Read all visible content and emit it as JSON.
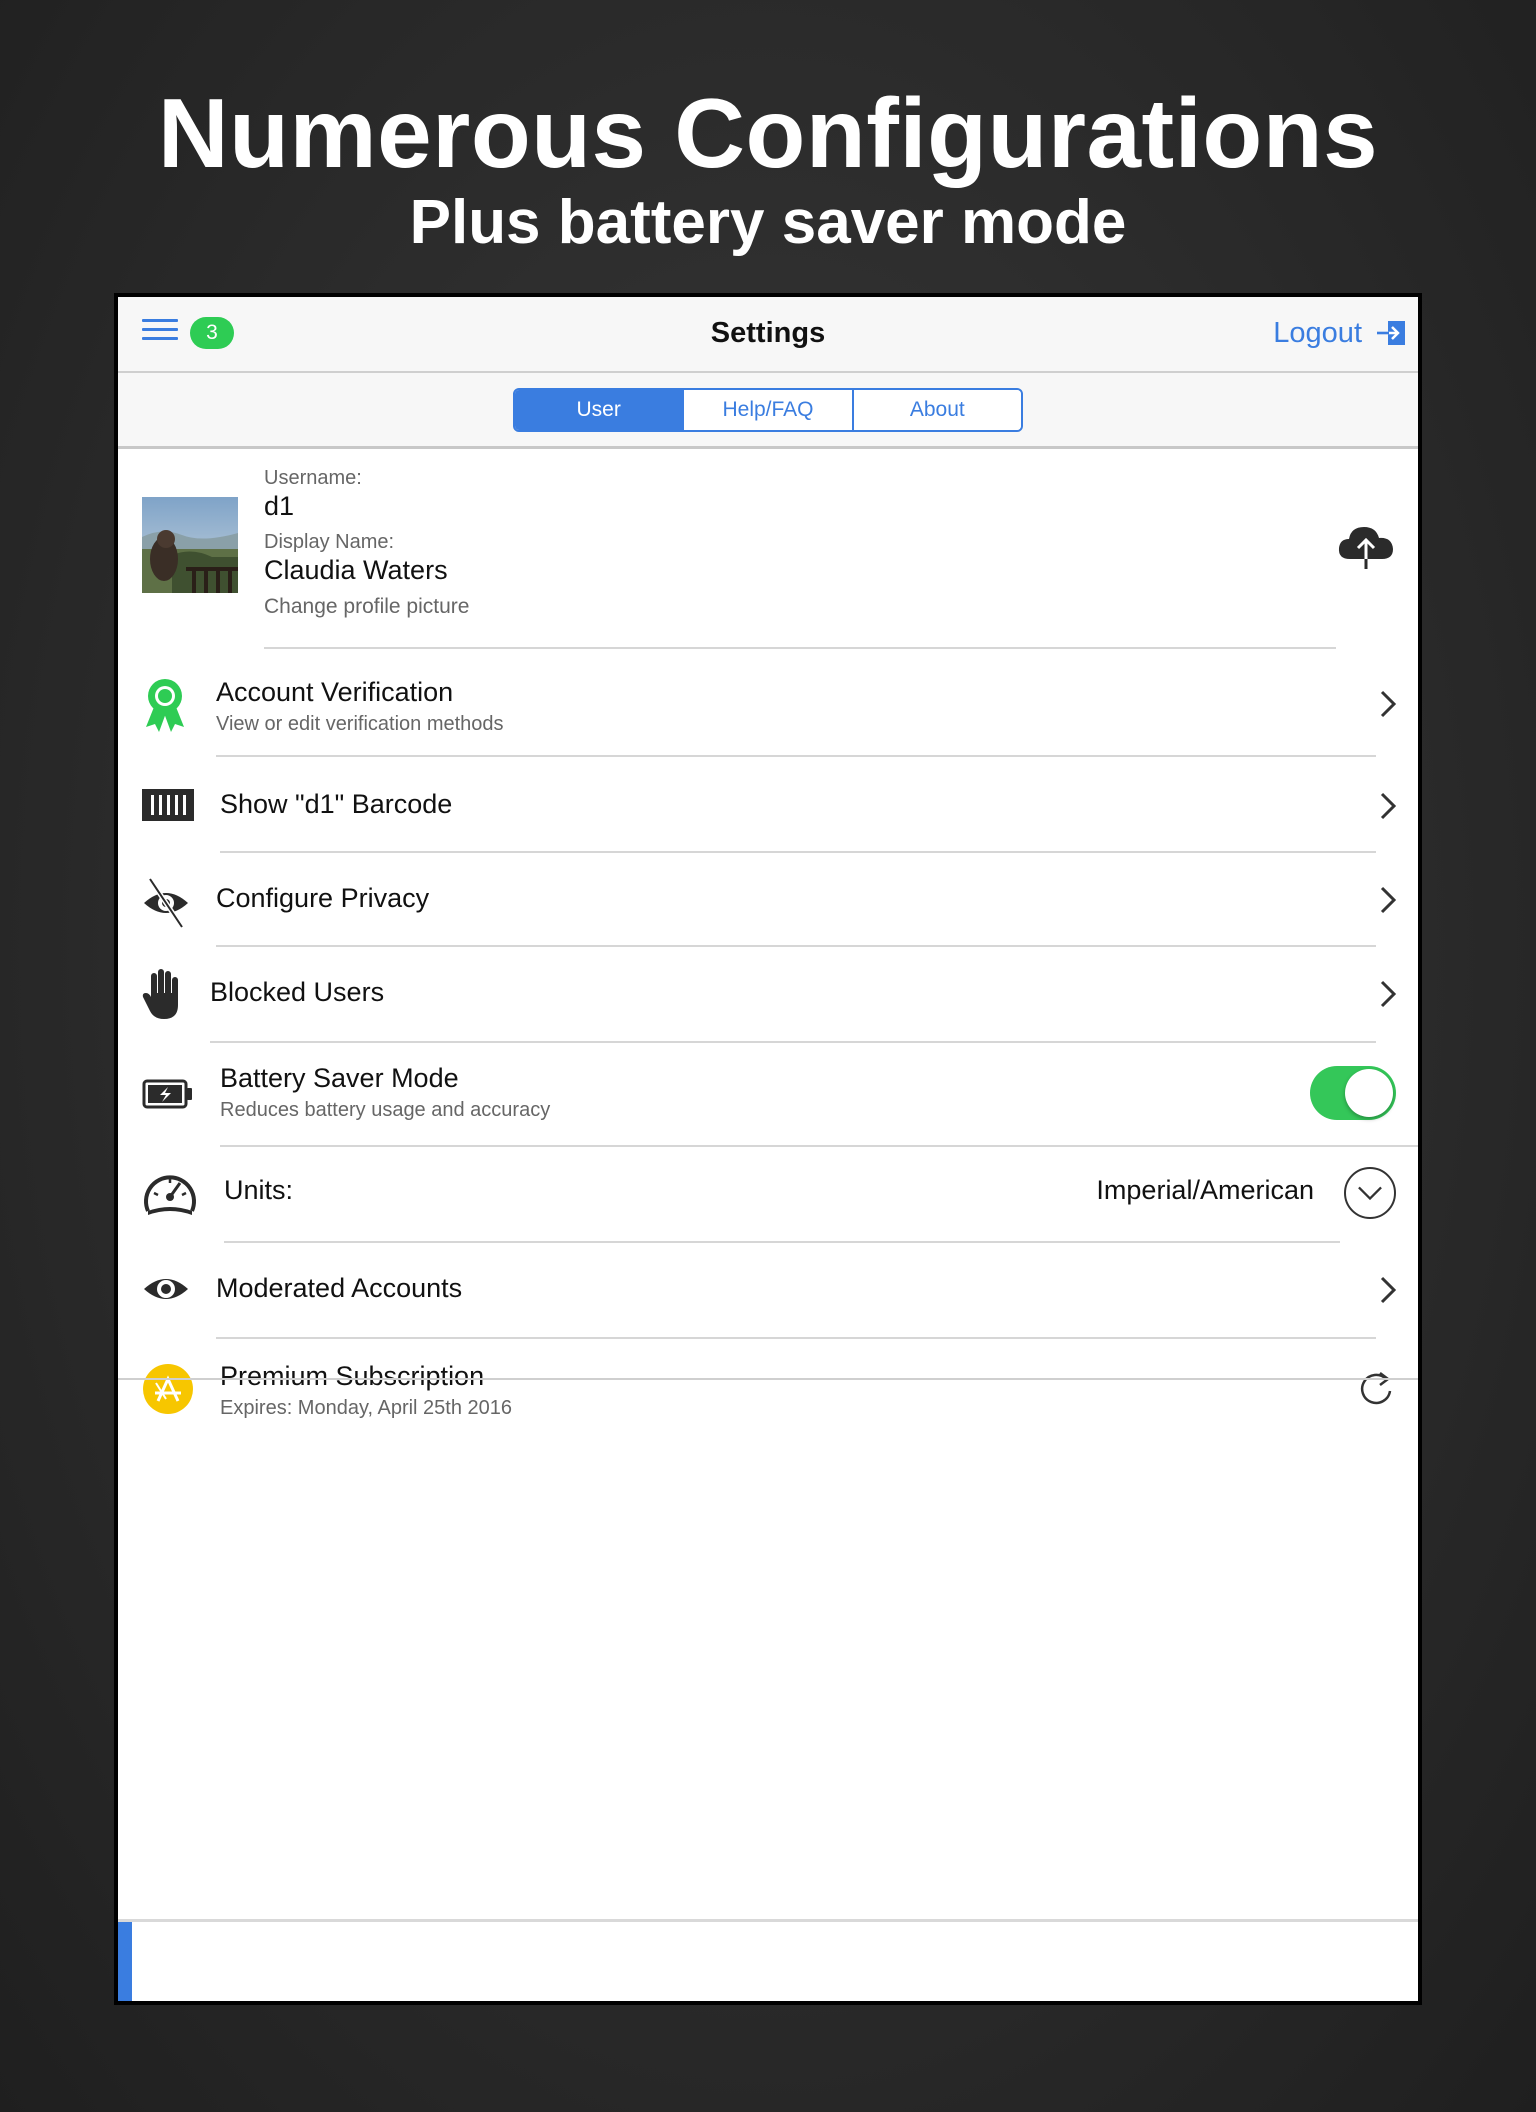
{
  "promo": {
    "headline": "Numerous Configurations",
    "subheadline": "Plus battery saver mode"
  },
  "nav": {
    "menu_icon": "hamburger-icon",
    "badge_count": "3",
    "title": "Settings",
    "logout_label": "Logout",
    "logout_icon": "logout-arrow-icon"
  },
  "tabs": [
    {
      "label": "User",
      "active": true
    },
    {
      "label": "Help/FAQ",
      "active": false
    },
    {
      "label": "About",
      "active": false
    }
  ],
  "profile": {
    "username_label": "Username:",
    "username": "d1",
    "display_name_label": "Display Name:",
    "display_name": "Claudia Waters",
    "change_picture": "Change profile picture",
    "upload_icon": "cloud-upload-icon"
  },
  "settings": {
    "account_verification": {
      "title": "Account Verification",
      "subtitle": "View or edit verification methods",
      "icon": "ribbon-award-icon"
    },
    "barcode": {
      "title": "Show \"d1\" Barcode",
      "icon": "barcode-icon"
    },
    "privacy": {
      "title": "Configure Privacy",
      "icon": "eye-slash-icon"
    },
    "blocked": {
      "title": "Blocked Users",
      "icon": "hand-stop-icon"
    },
    "battery": {
      "title": "Battery Saver Mode",
      "subtitle": "Reduces battery usage and accuracy",
      "icon": "battery-icon",
      "enabled": true
    },
    "units": {
      "title": "Units:",
      "value": "Imperial/American",
      "icon": "speedometer-icon"
    },
    "moderated": {
      "title": "Moderated Accounts",
      "icon": "eye-icon"
    },
    "premium": {
      "title": "Premium Subscription",
      "subtitle": "Expires: Monday, April 25th 2016",
      "icon": "app-store-icon",
      "action_icon": "refresh-icon"
    }
  },
  "colors": {
    "accent": "#3a7de0",
    "badge": "#2ecc54",
    "toggle_on": "#34c759",
    "verification": "#2ecc54",
    "premium": "#f7c600"
  }
}
